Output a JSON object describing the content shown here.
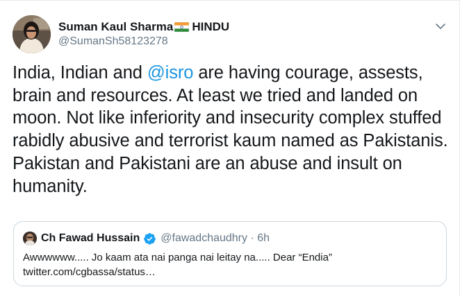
{
  "tweet": {
    "author": {
      "display_name": "Suman Kaul Sharma",
      "name_suffix": "HINDU",
      "handle": "@SumanSh58123278",
      "avatar_icon": "user-avatar-photo",
      "flag_icon": "india-flag-icon"
    },
    "text": {
      "part1": "India, Indian and ",
      "mention": "@isro",
      "part2": " are having courage, assests, brain and resources. At least we tried and landed on moon. Not like inferiority and insecurity complex stuffed rabidly abusive and terrorist kaum named as Pakistanis. Pakistan and Pakistani are an abuse and insult on humanity."
    },
    "menu_icon": "chevron-down-icon",
    "colors": {
      "link": "#1b95e0",
      "secondary": "#657786",
      "border": "#ccd6dd",
      "verified": "#1da1f2"
    }
  },
  "quoted": {
    "author": {
      "display_name": "Ch Fawad Hussain",
      "verified_icon": "verified-badge-icon",
      "handle_time": "@fawadchaudhry · 6h"
    },
    "text_line1": "Awwwwww..... Jo kaam ata nai panga nai leitay na..... Dear “Endia”",
    "text_line2": "twitter.com/cgbassa/status…"
  }
}
